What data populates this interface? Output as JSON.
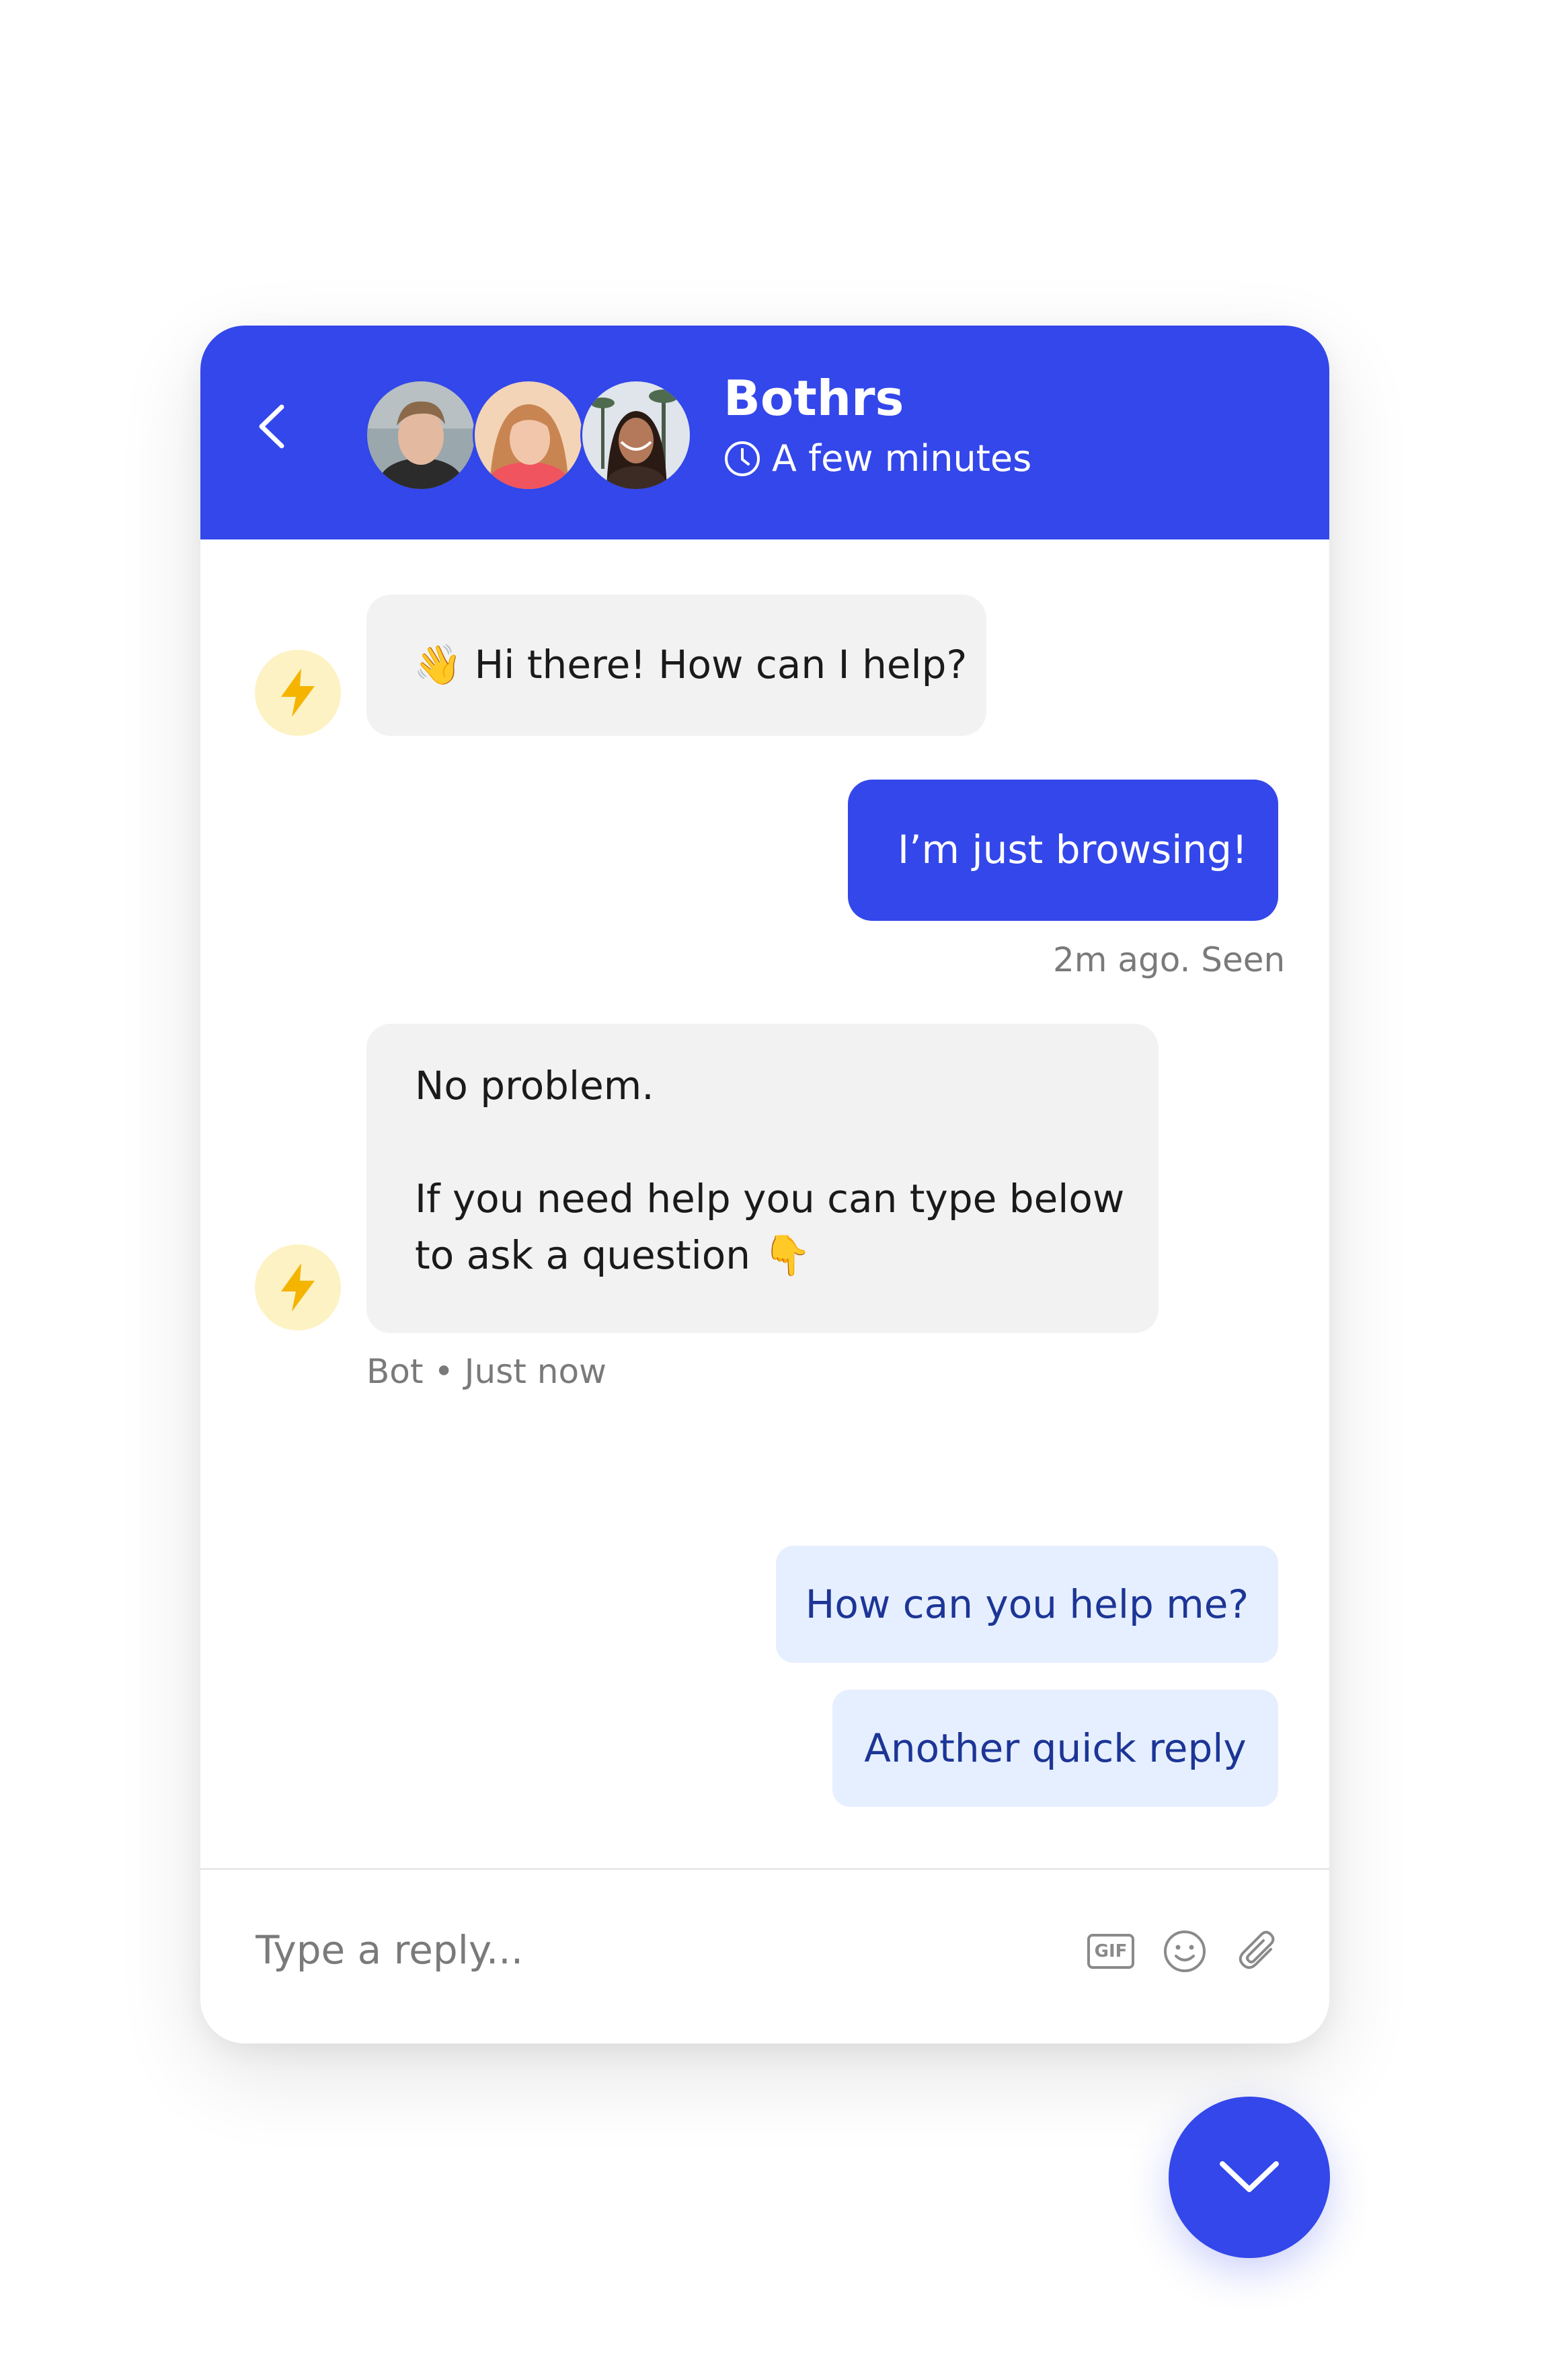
{
  "header": {
    "title": "Bothrs",
    "status": "A few minutes",
    "accent_color": "#3347ea"
  },
  "messages": [
    {
      "from": "bot",
      "emoji": "👋",
      "text": "Hi there! How can I help?"
    },
    {
      "from": "user",
      "text": "I’m just browsing!",
      "meta": "2m ago. Seen"
    },
    {
      "from": "bot",
      "line1": "No problem.",
      "line2": "If you need help you can type below",
      "line3": "to ask a question",
      "emoji": "👇",
      "meta": "Bot • Just now"
    }
  ],
  "quick_replies": [
    "How can you help me?",
    "Another quick reply"
  ],
  "composer": {
    "placeholder": "Type a reply...",
    "gif_label": "GIF"
  },
  "icons": {
    "back": "chevron-left-icon",
    "clock": "clock-icon",
    "bot": "lightning-bolt-icon",
    "gif": "gif-icon",
    "emoji": "smiley-icon",
    "attach": "paperclip-icon",
    "fab": "chevron-down-icon"
  }
}
